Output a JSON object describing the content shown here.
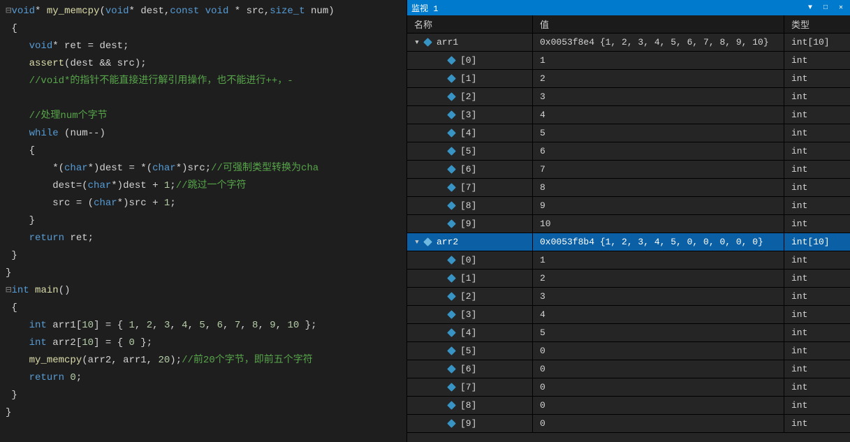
{
  "watch": {
    "panel_title": "监视 1",
    "header": {
      "name": "名称",
      "value": "值",
      "type": "类型"
    },
    "rows": [
      {
        "level": 0,
        "expand": "▼",
        "name": "arr1",
        "value": "0x0053f8e4 {1, 2, 3, 4, 5, 6, 7, 8, 9, 10}",
        "type": "int[10]",
        "selected": false
      },
      {
        "level": 1,
        "expand": "",
        "name": "[0]",
        "value": "1",
        "type": "int"
      },
      {
        "level": 1,
        "expand": "",
        "name": "[1]",
        "value": "2",
        "type": "int"
      },
      {
        "level": 1,
        "expand": "",
        "name": "[2]",
        "value": "3",
        "type": "int"
      },
      {
        "level": 1,
        "expand": "",
        "name": "[3]",
        "value": "4",
        "type": "int"
      },
      {
        "level": 1,
        "expand": "",
        "name": "[4]",
        "value": "5",
        "type": "int"
      },
      {
        "level": 1,
        "expand": "",
        "name": "[5]",
        "value": "6",
        "type": "int"
      },
      {
        "level": 1,
        "expand": "",
        "name": "[6]",
        "value": "7",
        "type": "int"
      },
      {
        "level": 1,
        "expand": "",
        "name": "[7]",
        "value": "8",
        "type": "int"
      },
      {
        "level": 1,
        "expand": "",
        "name": "[8]",
        "value": "9",
        "type": "int"
      },
      {
        "level": 1,
        "expand": "",
        "name": "[9]",
        "value": "10",
        "type": "int"
      },
      {
        "level": 0,
        "expand": "▼",
        "name": "arr2",
        "value": "0x0053f8b4 {1, 2, 3, 4, 5, 0, 0, 0, 0, 0}",
        "type": "int[10]",
        "selected": true
      },
      {
        "level": 1,
        "expand": "",
        "name": "[0]",
        "value": "1",
        "type": "int"
      },
      {
        "level": 1,
        "expand": "",
        "name": "[1]",
        "value": "2",
        "type": "int"
      },
      {
        "level": 1,
        "expand": "",
        "name": "[2]",
        "value": "3",
        "type": "int"
      },
      {
        "level": 1,
        "expand": "",
        "name": "[3]",
        "value": "4",
        "type": "int"
      },
      {
        "level": 1,
        "expand": "",
        "name": "[4]",
        "value": "5",
        "type": "int"
      },
      {
        "level": 1,
        "expand": "",
        "name": "[5]",
        "value": "0",
        "type": "int"
      },
      {
        "level": 1,
        "expand": "",
        "name": "[6]",
        "value": "0",
        "type": "int"
      },
      {
        "level": 1,
        "expand": "",
        "name": "[7]",
        "value": "0",
        "type": "int"
      },
      {
        "level": 1,
        "expand": "",
        "name": "[8]",
        "value": "0",
        "type": "int"
      },
      {
        "level": 1,
        "expand": "",
        "name": "[9]",
        "value": "0",
        "type": "int"
      }
    ]
  },
  "code": {
    "lines": [
      [
        [
          "gut",
          "⊟"
        ],
        [
          "t",
          "void"
        ],
        [
          "op",
          "* "
        ],
        [
          "fn",
          "my_memcpy"
        ],
        [
          "p",
          "("
        ],
        [
          "t",
          "void"
        ],
        [
          "op",
          "* "
        ],
        [
          "id",
          "dest"
        ],
        [
          "p",
          ","
        ],
        [
          "t",
          "const void "
        ],
        [
          "op",
          "* "
        ],
        [
          "id",
          "src"
        ],
        [
          "p",
          ","
        ],
        [
          "t",
          "size_t"
        ],
        [
          "id",
          " num"
        ],
        [
          "p",
          ")"
        ]
      ],
      [
        [
          "w",
          " "
        ],
        [
          "p",
          "{"
        ]
      ],
      [
        [
          "w",
          "    "
        ],
        [
          "t",
          "void"
        ],
        [
          "op",
          "* "
        ],
        [
          "id",
          "ret"
        ],
        [
          "op",
          " = "
        ],
        [
          "id",
          "dest"
        ],
        [
          "p",
          ";"
        ]
      ],
      [
        [
          "w",
          "    "
        ],
        [
          "fn",
          "assert"
        ],
        [
          "p",
          "("
        ],
        [
          "id",
          "dest"
        ],
        [
          "op",
          " && "
        ],
        [
          "id",
          "src"
        ],
        [
          "p",
          ");"
        ]
      ],
      [
        [
          "w",
          "    "
        ],
        [
          "c",
          "//void*的指针不能直接进行解引用操作，也不能进行++，-"
        ]
      ],
      [
        [
          "w",
          " "
        ]
      ],
      [
        [
          "w",
          "    "
        ],
        [
          "c",
          "//处理num个字节"
        ]
      ],
      [
        [
          "w",
          "    "
        ],
        [
          "k",
          "while"
        ],
        [
          "p",
          " ("
        ],
        [
          "id",
          "num"
        ],
        [
          "op",
          "--"
        ],
        [
          "p",
          ")"
        ]
      ],
      [
        [
          "w",
          "    "
        ],
        [
          "p",
          "{"
        ]
      ],
      [
        [
          "w",
          "        "
        ],
        [
          "op",
          "*"
        ],
        [
          "p",
          "("
        ],
        [
          "t",
          "char"
        ],
        [
          "op",
          "*"
        ],
        [
          "p",
          ")"
        ],
        [
          "id",
          "dest"
        ],
        [
          "op",
          " = "
        ],
        [
          "op",
          "*"
        ],
        [
          "p",
          "("
        ],
        [
          "t",
          "char"
        ],
        [
          "op",
          "*"
        ],
        [
          "p",
          ")"
        ],
        [
          "id",
          "src"
        ],
        [
          "p",
          ";"
        ],
        [
          "c",
          "//可强制类型转换为cha"
        ]
      ],
      [
        [
          "w",
          "        "
        ],
        [
          "id",
          "dest"
        ],
        [
          "op",
          "="
        ],
        [
          "p",
          "("
        ],
        [
          "t",
          "char"
        ],
        [
          "op",
          "*"
        ],
        [
          "p",
          ")"
        ],
        [
          "id",
          "dest"
        ],
        [
          "op",
          " + "
        ],
        [
          "n",
          "1"
        ],
        [
          "p",
          ";"
        ],
        [
          "c",
          "//跳过一个字符"
        ]
      ],
      [
        [
          "w",
          "        "
        ],
        [
          "id",
          "src"
        ],
        [
          "op",
          " = "
        ],
        [
          "p",
          "("
        ],
        [
          "t",
          "char"
        ],
        [
          "op",
          "*"
        ],
        [
          "p",
          ")"
        ],
        [
          "id",
          "src"
        ],
        [
          "op",
          " + "
        ],
        [
          "n",
          "1"
        ],
        [
          "p",
          ";"
        ]
      ],
      [
        [
          "w",
          "    "
        ],
        [
          "p",
          "}"
        ]
      ],
      [
        [
          "w",
          "    "
        ],
        [
          "k",
          "return"
        ],
        [
          "id",
          " ret"
        ],
        [
          "p",
          ";"
        ]
      ],
      [
        [
          "w",
          " "
        ],
        [
          "p",
          "}"
        ]
      ],
      [
        [
          "p",
          "}"
        ]
      ],
      [
        [
          "gut",
          "⊟"
        ],
        [
          "t",
          "int"
        ],
        [
          "fn",
          " main"
        ],
        [
          "p",
          "()"
        ]
      ],
      [
        [
          "w",
          " "
        ],
        [
          "p",
          "{"
        ]
      ],
      [
        [
          "w",
          "    "
        ],
        [
          "t",
          "int"
        ],
        [
          "id",
          " arr1"
        ],
        [
          "p",
          "["
        ],
        [
          "n",
          "10"
        ],
        [
          "p",
          "]"
        ],
        [
          "op",
          " = "
        ],
        [
          "p",
          "{ "
        ],
        [
          "n",
          "1"
        ],
        [
          "p",
          ", "
        ],
        [
          "n",
          "2"
        ],
        [
          "p",
          ", "
        ],
        [
          "n",
          "3"
        ],
        [
          "p",
          ", "
        ],
        [
          "n",
          "4"
        ],
        [
          "p",
          ", "
        ],
        [
          "n",
          "5"
        ],
        [
          "p",
          ", "
        ],
        [
          "n",
          "6"
        ],
        [
          "p",
          ", "
        ],
        [
          "n",
          "7"
        ],
        [
          "p",
          ", "
        ],
        [
          "n",
          "8"
        ],
        [
          "p",
          ", "
        ],
        [
          "n",
          "9"
        ],
        [
          "p",
          ", "
        ],
        [
          "n",
          "10"
        ],
        [
          "p",
          " };"
        ]
      ],
      [
        [
          "w",
          "    "
        ],
        [
          "t",
          "int"
        ],
        [
          "id",
          " arr2"
        ],
        [
          "p",
          "["
        ],
        [
          "n",
          "10"
        ],
        [
          "p",
          "]"
        ],
        [
          "op",
          " = "
        ],
        [
          "p",
          "{ "
        ],
        [
          "n",
          "0"
        ],
        [
          "p",
          " };"
        ]
      ],
      [
        [
          "w",
          "    "
        ],
        [
          "fn",
          "my_memcpy"
        ],
        [
          "p",
          "("
        ],
        [
          "id",
          "arr2"
        ],
        [
          "p",
          ", "
        ],
        [
          "id",
          "arr1"
        ],
        [
          "p",
          ", "
        ],
        [
          "n",
          "20"
        ],
        [
          "p",
          ");"
        ],
        [
          "c",
          "//前20个字节，即前五个字符"
        ]
      ],
      [
        [
          "w",
          "    "
        ],
        [
          "k",
          "return"
        ],
        [
          "n",
          " 0"
        ],
        [
          "p",
          ";"
        ]
      ],
      [
        [
          "w",
          " "
        ],
        [
          "p",
          "}"
        ]
      ],
      [
        [
          "p",
          "}"
        ]
      ]
    ]
  }
}
